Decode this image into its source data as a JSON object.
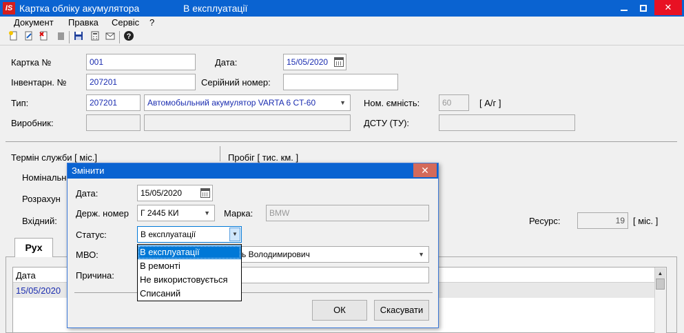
{
  "window": {
    "title": "Картка обліку акумулятора",
    "status": "В експлуатації",
    "logo_text": "IS"
  },
  "menu": [
    "Документ",
    "Правка",
    "Сервіс",
    "?"
  ],
  "toolbar": {
    "icons": [
      "new-doc-icon",
      "edit-doc-icon",
      "delete-doc-icon",
      "disabled-icon",
      "save-icon",
      "calculator-icon",
      "mail-icon",
      "help-icon"
    ],
    "help_glyph": "?"
  },
  "form": {
    "card_no_label": "Картка №",
    "card_no_value": "001",
    "date_label": "Дата:",
    "date_value": "15/05/2020",
    "inventory_label": "Інвентарн. №",
    "inventory_value": "207201",
    "serial_label": "Серійний номер:",
    "serial_value": "",
    "type_label": "Тип:",
    "type_code": "207201",
    "type_name": "Автомобыльний акумулятор VARTA 6 CT-60",
    "capacity_label": "Ном. ємність:",
    "capacity_value": "60",
    "capacity_unit": "[ А/г ]",
    "maker_label": "Виробник:",
    "dstu_label": "ДСТУ (ТУ):",
    "service_life_label": "Термін служби [ міс.]",
    "mileage_label": "Пробіг [ тис. км. ]",
    "nominal_label": "Номінальн",
    "calculated_label": "Розрахун",
    "input_label": "Вхідний:",
    "resource_label": "Ресурс:",
    "resource_value": "19",
    "resource_unit": "[ міс. ]"
  },
  "tabs": {
    "movement_label": "Рух"
  },
  "grid": {
    "columns": [
      "Дата"
    ],
    "rows": [
      {
        "date": "15/05/2020"
      }
    ]
  },
  "dialog": {
    "title": "Змінити",
    "date_label": "Дата:",
    "date_value": "15/05/2020",
    "plate_label": "Держ. номер",
    "plate_value": "Г 2445 КИ",
    "brand_label": "Марка:",
    "brand_value": "BMW",
    "status_label": "Статус:",
    "status_value": "В експлуатації",
    "mvo_label": "МВО:",
    "mvo_value": "ь Володимирович",
    "reason_label": "Причина:",
    "reason_value": "",
    "ok_label": "ОК",
    "cancel_label": "Скасувати",
    "status_options": [
      "В експлуатації",
      "В ремонті",
      "Не використовується",
      "Списаний"
    ],
    "selected_option_index": 0
  },
  "colors": {
    "titlebar": "#0a63d1",
    "close_button": "#e81123",
    "selection": "#0078d7",
    "field_text": "#1a2cb0"
  }
}
